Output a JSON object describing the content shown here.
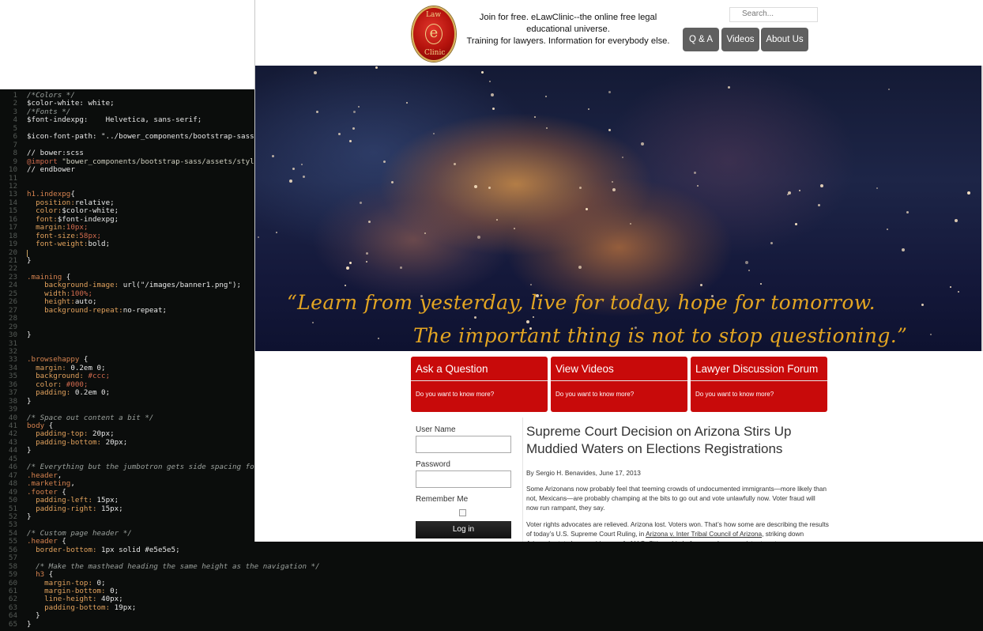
{
  "editor": {
    "lines": [
      {
        "n": "1",
        "parts": [
          {
            "t": "/*Colors */",
            "c": "comment"
          }
        ]
      },
      {
        "n": "2",
        "parts": [
          {
            "t": "$color-white: white;",
            "c": "var"
          }
        ]
      },
      {
        "n": "3",
        "parts": [
          {
            "t": "/*Fonts */",
            "c": "comment"
          }
        ]
      },
      {
        "n": "4",
        "parts": [
          {
            "t": "$font-indexpg:    Helvetica, sans-serif;",
            "c": "var"
          }
        ]
      },
      {
        "n": "5",
        "parts": []
      },
      {
        "n": "6",
        "parts": [
          {
            "t": "$icon-font-path: \"../bower_components/bootstrap-sass/as",
            "c": "var"
          }
        ]
      },
      {
        "n": "7",
        "parts": []
      },
      {
        "n": "8",
        "parts": [
          {
            "t": "// bower:scss",
            "c": "plain"
          }
        ]
      },
      {
        "n": "9",
        "parts": [
          {
            "t": "@import ",
            "c": "import"
          },
          {
            "t": "\"bower_components/bootstrap-sass/assets/stylesh",
            "c": "string"
          }
        ]
      },
      {
        "n": "10",
        "parts": [
          {
            "t": "// endbower",
            "c": "plain"
          }
        ]
      },
      {
        "n": "11",
        "parts": []
      },
      {
        "n": "12",
        "parts": []
      },
      {
        "n": "13",
        "parts": [
          {
            "t": "h1.indexpg",
            "c": "sel"
          },
          {
            "t": "{",
            "c": "brace"
          }
        ]
      },
      {
        "n": "14",
        "parts": [
          {
            "t": "  position:",
            "c": "prop"
          },
          {
            "t": "relative;",
            "c": "plain"
          }
        ]
      },
      {
        "n": "15",
        "parts": [
          {
            "t": "  color:",
            "c": "prop"
          },
          {
            "t": "$color-white;",
            "c": "plain"
          }
        ]
      },
      {
        "n": "16",
        "parts": [
          {
            "t": "  font:",
            "c": "prop"
          },
          {
            "t": "$font-indexpg;",
            "c": "plain"
          }
        ]
      },
      {
        "n": "17",
        "parts": [
          {
            "t": "  margin:",
            "c": "prop"
          },
          {
            "t": "10px;",
            "c": "import"
          }
        ]
      },
      {
        "n": "18",
        "parts": [
          {
            "t": "  font-size:",
            "c": "prop"
          },
          {
            "t": "58px;",
            "c": "import"
          }
        ]
      },
      {
        "n": "19",
        "parts": [
          {
            "t": "  font-weight:",
            "c": "prop"
          },
          {
            "t": "bold;",
            "c": "plain"
          }
        ]
      },
      {
        "n": "20",
        "parts": [],
        "cursor": true
      },
      {
        "n": "21",
        "parts": [
          {
            "t": "}",
            "c": "brace"
          }
        ]
      },
      {
        "n": "22",
        "parts": []
      },
      {
        "n": "23",
        "parts": [
          {
            "t": ".maining ",
            "c": "sel"
          },
          {
            "t": "{",
            "c": "brace"
          }
        ]
      },
      {
        "n": "24",
        "parts": [
          {
            "t": "    background-image: ",
            "c": "prop"
          },
          {
            "t": "url(\"/images/banner1.png\");",
            "c": "plain"
          }
        ]
      },
      {
        "n": "25",
        "parts": [
          {
            "t": "    width:",
            "c": "prop"
          },
          {
            "t": "100%;",
            "c": "import"
          }
        ]
      },
      {
        "n": "26",
        "parts": [
          {
            "t": "    height:",
            "c": "prop"
          },
          {
            "t": "auto;",
            "c": "plain"
          }
        ]
      },
      {
        "n": "27",
        "parts": [
          {
            "t": "    background-repeat:",
            "c": "prop"
          },
          {
            "t": "no-repeat;",
            "c": "plain"
          }
        ]
      },
      {
        "n": "28",
        "parts": []
      },
      {
        "n": "29",
        "parts": []
      },
      {
        "n": "30",
        "parts": [
          {
            "t": "}",
            "c": "brace"
          }
        ]
      },
      {
        "n": "31",
        "parts": []
      },
      {
        "n": "32",
        "parts": []
      },
      {
        "n": "33",
        "parts": [
          {
            "t": ".browsehappy ",
            "c": "sel"
          },
          {
            "t": "{",
            "c": "brace"
          }
        ]
      },
      {
        "n": "34",
        "parts": [
          {
            "t": "  margin: ",
            "c": "prop"
          },
          {
            "t": "0.2em 0;",
            "c": "plain"
          }
        ]
      },
      {
        "n": "35",
        "parts": [
          {
            "t": "  background: ",
            "c": "prop"
          },
          {
            "t": "#ccc;",
            "c": "import"
          }
        ]
      },
      {
        "n": "36",
        "parts": [
          {
            "t": "  color: ",
            "c": "prop"
          },
          {
            "t": "#000;",
            "c": "import"
          }
        ]
      },
      {
        "n": "37",
        "parts": [
          {
            "t": "  padding: ",
            "c": "prop"
          },
          {
            "t": "0.2em 0;",
            "c": "plain"
          }
        ]
      },
      {
        "n": "38",
        "parts": [
          {
            "t": "}",
            "c": "brace"
          }
        ]
      },
      {
        "n": "39",
        "parts": []
      },
      {
        "n": "40",
        "parts": [
          {
            "t": "/* Space out content a bit */",
            "c": "comment"
          }
        ]
      },
      {
        "n": "41",
        "parts": [
          {
            "t": "body ",
            "c": "sel"
          },
          {
            "t": "{",
            "c": "brace"
          }
        ]
      },
      {
        "n": "42",
        "parts": [
          {
            "t": "  padding-top: ",
            "c": "prop"
          },
          {
            "t": "20px;",
            "c": "plain"
          }
        ]
      },
      {
        "n": "43",
        "parts": [
          {
            "t": "  padding-bottom: ",
            "c": "prop"
          },
          {
            "t": "20px;",
            "c": "plain"
          }
        ]
      },
      {
        "n": "44",
        "parts": [
          {
            "t": "}",
            "c": "brace"
          }
        ]
      },
      {
        "n": "45",
        "parts": []
      },
      {
        "n": "46",
        "parts": [
          {
            "t": "/* Everything but the jumbotron gets side spacing for m",
            "c": "comment"
          }
        ]
      },
      {
        "n": "47",
        "parts": [
          {
            "t": ".header",
            "c": "sel"
          },
          {
            "t": ",",
            "c": "plain"
          }
        ]
      },
      {
        "n": "48",
        "parts": [
          {
            "t": ".marketing",
            "c": "sel"
          },
          {
            "t": ",",
            "c": "plain"
          }
        ]
      },
      {
        "n": "49",
        "parts": [
          {
            "t": ".footer ",
            "c": "sel"
          },
          {
            "t": "{",
            "c": "brace"
          }
        ]
      },
      {
        "n": "50",
        "parts": [
          {
            "t": "  padding-left: ",
            "c": "prop"
          },
          {
            "t": "15px;",
            "c": "plain"
          }
        ]
      },
      {
        "n": "51",
        "parts": [
          {
            "t": "  padding-right: ",
            "c": "prop"
          },
          {
            "t": "15px;",
            "c": "plain"
          }
        ]
      },
      {
        "n": "52",
        "parts": [
          {
            "t": "}",
            "c": "brace"
          }
        ]
      },
      {
        "n": "53",
        "parts": []
      },
      {
        "n": "54",
        "parts": [
          {
            "t": "/* Custom page header */",
            "c": "comment"
          }
        ]
      },
      {
        "n": "55",
        "parts": [
          {
            "t": ".header ",
            "c": "sel"
          },
          {
            "t": "{",
            "c": "brace"
          }
        ]
      },
      {
        "n": "56",
        "parts": [
          {
            "t": "  border-bottom: ",
            "c": "prop"
          },
          {
            "t": "1px solid #e5e5e5;",
            "c": "plain"
          }
        ]
      },
      {
        "n": "57",
        "parts": []
      },
      {
        "n": "58",
        "parts": [
          {
            "t": "  /* Make the masthead heading the same height as the navigation */",
            "c": "comment"
          }
        ]
      },
      {
        "n": "59",
        "parts": [
          {
            "t": "  h3 ",
            "c": "sel"
          },
          {
            "t": "{",
            "c": "brace"
          }
        ]
      },
      {
        "n": "60",
        "parts": [
          {
            "t": "    margin-top: ",
            "c": "prop"
          },
          {
            "t": "0;",
            "c": "plain"
          }
        ]
      },
      {
        "n": "61",
        "parts": [
          {
            "t": "    margin-bottom: ",
            "c": "prop"
          },
          {
            "t": "0;",
            "c": "plain"
          }
        ]
      },
      {
        "n": "62",
        "parts": [
          {
            "t": "    line-height: ",
            "c": "prop"
          },
          {
            "t": "40px;",
            "c": "plain"
          }
        ]
      },
      {
        "n": "63",
        "parts": [
          {
            "t": "    padding-bottom: ",
            "c": "prop"
          },
          {
            "t": "19px;",
            "c": "plain"
          }
        ]
      },
      {
        "n": "64",
        "parts": [
          {
            "t": "  }",
            "c": "brace"
          }
        ]
      },
      {
        "n": "65",
        "parts": [
          {
            "t": "}",
            "c": "brace"
          }
        ]
      }
    ],
    "colors": {
      "background": "#0b0d0c",
      "comment": "#9aa09c",
      "selector": "#d5824f",
      "property": "#e2a25d",
      "number": "#d06a4e"
    }
  },
  "site": {
    "logo": {
      "icon": "elawclinic-logo",
      "text_top": "Law",
      "text_center": "e",
      "text_bottom": "Clinic"
    },
    "tagline_line1": "Join for free. eLawClinic--the online free legal educational universe.",
    "tagline_line2": "Training for lawyers. Information for everybody else.",
    "search_placeholder": "Search...",
    "nav": [
      {
        "label": "Q & A"
      },
      {
        "label": "Videos"
      },
      {
        "label": "About Us"
      }
    ],
    "banner": {
      "quote_line1": "“Learn from yesterday, live for today, hope for tomorrow.",
      "quote_line2": "The important thing is not to stop questioning.”",
      "quote_color": "#e3a522"
    },
    "features": [
      {
        "title": "Ask a Question",
        "subtitle": "Do you want to know more?"
      },
      {
        "title": "View Videos",
        "subtitle": "Do you want to know more?"
      },
      {
        "title": "Lawyer Discussion Forum",
        "subtitle": "Do you want to know more?"
      }
    ],
    "feature_color": "#c80a0a",
    "login": {
      "username_label": "User Name",
      "password_label": "Password",
      "remember_label": "Remember Me",
      "button_label": "Log in"
    },
    "article": {
      "title": "Supreme Court Decision on Arizona Stirs Up Muddied Waters on Elections Registrations",
      "byline": "By Sergio H. Benavides, June 17, 2013",
      "p1": "Some Arizonans now probably feel that teeming crowds of undocumented immigrants—more likely than not, Mexicans—are probably champing at the bits to go out and vote unlawfully now. Voter fraud will now run rampant, they say.",
      "p2_before": "Voter rights advocates are relieved. Arizona lost. Voters won. That’s how some are describing the results of today’s U.S. Supreme Court Ruling, in ",
      "p2_link": "Arizona v. Inter Tribal Council of Arizona",
      "p2_after": ", striking down Arizona’s state law requiring proof of U.S. Citizenship before people can register to vote."
    }
  }
}
